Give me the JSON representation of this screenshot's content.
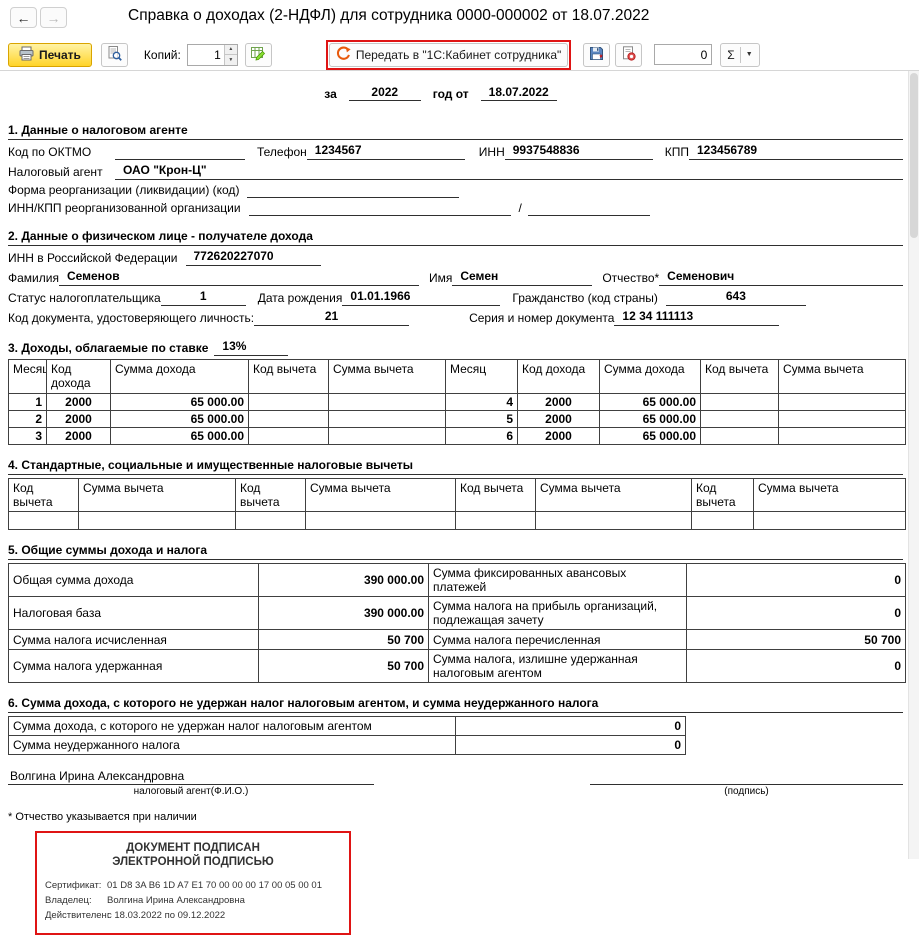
{
  "window": {
    "title": "Справка о доходах (2-НДФЛ) для сотрудника 0000-000002 от 18.07.2022"
  },
  "icons": {
    "back": "←",
    "forward": "→",
    "spin_up": "▲",
    "spin_down": "▼",
    "caret_down": "▼"
  },
  "colors": {
    "annotation_red": "#df1414",
    "print_button_yellow": "#ffd42a",
    "transfer_icon_orange": "#e8590c"
  },
  "toolbar": {
    "print_label": "Печать",
    "copies_label": "Копий:",
    "copies_value": "1",
    "transfer_label": "Передать в \"1С:Кабинет сотрудника\"",
    "counter_value": "0",
    "sigma_label": "Σ"
  },
  "doc": {
    "period": {
      "pre": "за",
      "year": "2022",
      "mid": "год от",
      "date": "18.07.2022"
    },
    "s1": {
      "title": "1. Данные о налоговом агенте",
      "oktmo_label": "Код по ОКТМО",
      "phone_label": "Телефон",
      "phone": "1234567",
      "inn_label": "ИНН",
      "inn": "9937548836",
      "kpp_label": "КПП",
      "kpp": "123456789",
      "agent_label": "Налоговый агент",
      "agent": "ОАО \"Крон-Ц\"",
      "reorg_label": "Форма реорганизации (ликвидации)  (код)",
      "innkpp_label": "ИНН/КПП  реорганизованной организации",
      "slash": "/"
    },
    "s2": {
      "title": "2. Данные о физическом лице - получателе дохода",
      "inn_label": "ИНН в Российской Федерации",
      "inn": "772620227070",
      "lastname_label": "Фамилия",
      "lastname": "Семенов",
      "firstname_label": "Имя",
      "firstname": "Семен",
      "middlename_label": "Отчество*",
      "middlename": "Семенович",
      "status_label": "Статус налогоплательщика",
      "status": "1",
      "birthdate_label": "Дата рождения",
      "birthdate": "01.01.1966",
      "citizenship_label": "Гражданство (код страны)",
      "citizenship": "643",
      "doccode_label": "Код документа, удостоверяющего личность:",
      "doccode": "21",
      "docnum_label": "Серия и номер документа",
      "docnum": "12 34 111113"
    },
    "s3": {
      "title": "3. Доходы, облагаемые по ставке",
      "rate": "13%",
      "headers": [
        "Месяц",
        "Код дохода",
        "Сумма дохода",
        "Код вычета",
        "Сумма вычета"
      ],
      "left_rows": [
        [
          "1",
          "2000",
          "65 000.00"
        ],
        [
          "2",
          "2000",
          "65 000.00"
        ],
        [
          "3",
          "2000",
          "65 000.00"
        ]
      ],
      "right_rows": [
        [
          "4",
          "2000",
          "65 000.00"
        ],
        [
          "5",
          "2000",
          "65 000.00"
        ],
        [
          "6",
          "2000",
          "65 000.00"
        ]
      ]
    },
    "s4": {
      "title": "4. Стандартные, социальные и имущественные налоговые вычеты",
      "code_header": "Код вычета",
      "sum_header": "Сумма вычета"
    },
    "s5": {
      "title": "5. Общие суммы дохода и налога",
      "rows": [
        {
          "l_label": "Общая сумма дохода",
          "l_value": "390 000.00",
          "r_label": "Сумма фиксированных авансовых платежей",
          "r_value": "0"
        },
        {
          "l_label": "Налоговая база",
          "l_value": "390 000.00",
          "r_label": "Сумма налога на прибыль организаций, подлежащая зачету",
          "r_value": "0"
        },
        {
          "l_label": "Сумма налога исчисленная",
          "l_value": "50 700",
          "r_label": "Сумма налога перечисленная",
          "r_value": "50 700"
        },
        {
          "l_label": "Сумма налога удержанная",
          "l_value": "50 700",
          "r_label": "Сумма налога, излишне удержанная налоговым агентом",
          "r_value": "0"
        }
      ]
    },
    "s6": {
      "title": "6. Сумма дохода, с которого не удержан налог налоговым агентом, и сумма неудержанного налога",
      "rows": [
        {
          "label": "Сумма дохода, с которого не удержан налог налоговым агентом",
          "value": "0"
        },
        {
          "label": "Сумма неудержанного налога",
          "value": "0"
        }
      ]
    },
    "signature": {
      "name": "Волгина Ирина Александровна",
      "left_caption": "налоговый агент(Ф.И.О.)",
      "right_caption": "(подпись)"
    },
    "footnote": "* Отчество указывается при наличии",
    "stamp": {
      "line1": "ДОКУМЕНТ ПОДПИСАН",
      "line2": "ЭЛЕКТРОННОЙ ПОДПИСЬЮ",
      "cert_label": "Сертификат:",
      "cert": "01 D8 3A B6 1D A7 E1 70 00 00 00 17 00 05 00 01",
      "owner_label": "Владелец:",
      "owner": "Волгина Ирина Александровна",
      "valid_label": "Действителен:",
      "valid": "с 18.03.2022 по 09.12.2022"
    }
  }
}
